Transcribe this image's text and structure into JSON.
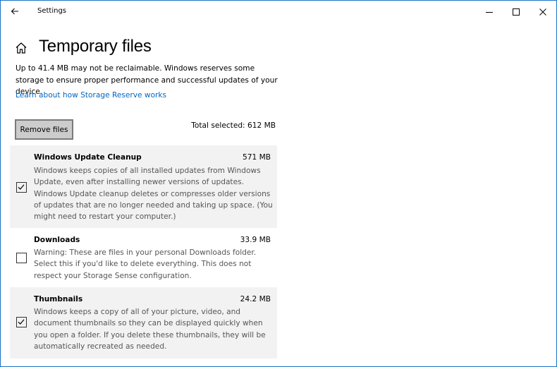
{
  "window": {
    "title": "Settings",
    "controls": [
      "minimize-icon",
      "maximize-icon",
      "close-icon"
    ]
  },
  "page": {
    "title": "Temporary files",
    "description": "Up to 41.4 MB may not be reclaimable. Windows reserves some storage to ensure proper performance and successful updates of your device.",
    "link": "Learn about how Storage Reserve works",
    "remove_button": "Remove files",
    "total_selected": "Total selected: 612 MB"
  },
  "items": [
    {
      "name": "Windows Update Cleanup",
      "size": "571 MB",
      "checked": true,
      "description": "Windows keeps copies of all installed updates from Windows Update, even after installing newer versions of updates. Windows Update cleanup deletes or compresses older versions of updates that are no longer needed and taking up space. (You might need to restart your computer.)"
    },
    {
      "name": "Downloads",
      "size": "33.9 MB",
      "checked": false,
      "description": "Warning: These are files in your personal Downloads folder. Select this if you'd like to delete everything. This does not respect your Storage Sense configuration."
    },
    {
      "name": "Thumbnails",
      "size": "24.2 MB",
      "checked": true,
      "description": "Windows keeps a copy of all of your picture, video, and document thumbnails so they can be displayed quickly when you open a folder. If you delete these thumbnails, they will be automatically recreated as needed."
    }
  ],
  "colors": {
    "accent_link": "#0067c0",
    "window_border": "#1a73c8",
    "item_background": "#f2f2f2",
    "button_background": "#cccccc"
  }
}
